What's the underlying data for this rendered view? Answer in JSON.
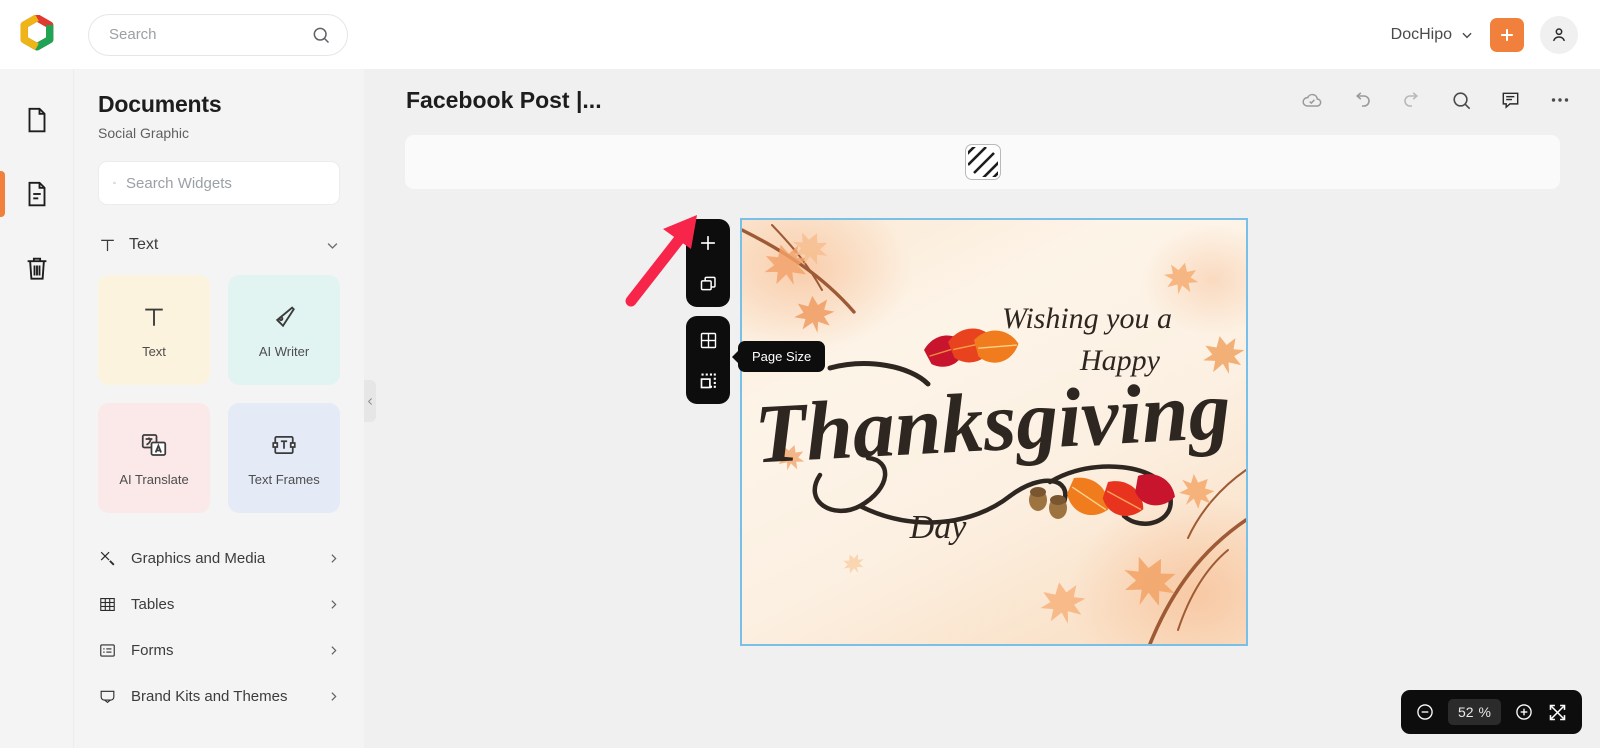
{
  "header": {
    "logo_name": "dochipo-logo",
    "search": {
      "value": "",
      "placeholder": "Search",
      "icon": "search-icon"
    },
    "brand": {
      "label": "DocHipo",
      "caret": "chevron-down-icon"
    },
    "create_button": {
      "icon": "plus-icon",
      "color": "#f0803c"
    },
    "account": {
      "icon": "user-avatar-icon"
    }
  },
  "rail": {
    "items": [
      {
        "name": "pages-icon",
        "label": "Pages",
        "active": false
      },
      {
        "name": "widgets-document-icon",
        "label": "Widgets",
        "active": true
      },
      {
        "name": "trash-icon",
        "label": "Trash",
        "active": false
      }
    ]
  },
  "panel": {
    "title": "Documents",
    "subtitle": "Social Graphic",
    "search": {
      "value": "",
      "placeholder": "Search Widgets",
      "icon": "search-icon"
    },
    "section": {
      "label": "Text",
      "icon": "text-t-icon",
      "caret": "chevron-down-icon",
      "expanded": true
    },
    "cards": [
      {
        "label": "Text",
        "icon": "text-t-icon",
        "bg": "#fcf3de"
      },
      {
        "label": "AI Writer",
        "icon": "pen-nib-icon",
        "bg": "#e2f4f2"
      },
      {
        "label": "AI Translate",
        "icon": "translate-icon",
        "bg": "#fbe8e8"
      },
      {
        "label": "Text Frames",
        "icon": "text-frame-icon",
        "bg": "#e4ebf7"
      }
    ],
    "menu": [
      {
        "label": "Graphics and Media",
        "icon": "graphics-media-icon",
        "chevron": "chevron-right-icon"
      },
      {
        "label": "Tables",
        "icon": "table-grid-icon",
        "chevron": "chevron-right-icon"
      },
      {
        "label": "Forms",
        "icon": "forms-icon",
        "chevron": "chevron-right-icon"
      },
      {
        "label": "Brand Kits and Themes",
        "icon": "brand-kit-icon",
        "chevron": "chevron-right-icon"
      }
    ],
    "collapse_handle": {
      "icon": "chevron-left-icon"
    }
  },
  "editor": {
    "document_title": "Facebook Post |...",
    "actions": [
      {
        "name": "cloud-saved-icon",
        "label": "Saved"
      },
      {
        "name": "undo-icon",
        "label": "Undo"
      },
      {
        "name": "redo-icon",
        "label": "Redo"
      },
      {
        "name": "search-icon",
        "label": "Search"
      },
      {
        "name": "comment-icon",
        "label": "Comments"
      },
      {
        "name": "more-options-icon",
        "label": "More"
      }
    ],
    "property_bar": {
      "swatch": {
        "name": "pattern-swatch",
        "label": "Background Pattern"
      }
    },
    "page_tools": {
      "group_one": [
        {
          "name": "add-page-icon",
          "label": "Add Page"
        },
        {
          "name": "duplicate-page-icon",
          "label": "Duplicate Page"
        }
      ],
      "group_two": [
        {
          "name": "grid-layout-icon",
          "label": "Page Layout"
        },
        {
          "name": "page-size-icon",
          "label": "Page Size",
          "selected": true
        }
      ],
      "tooltip": "Page Size"
    },
    "annotation": {
      "name": "red-arrow-pointer",
      "color": "#f8254a",
      "points_to": "Page Size"
    },
    "canvas": {
      "selected": true,
      "border_color": "#79c0e8",
      "design": {
        "line1": "Wishing you a",
        "line2": "Happy",
        "line3": "Thanksgiving",
        "line4": "Day",
        "background": "#fbefe0"
      }
    },
    "zoom": {
      "out_icon": "zoom-out-icon",
      "value": "52",
      "unit": "%",
      "in_icon": "zoom-in-icon",
      "fit_icon": "fit-screen-icon"
    }
  }
}
